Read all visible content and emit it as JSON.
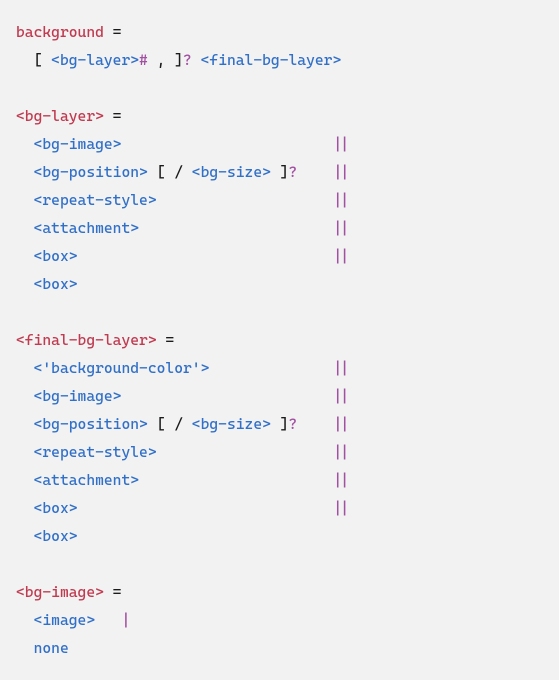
{
  "tokens": [
    {
      "id": "p1",
      "cls": "t-prop",
      "txt": "background"
    },
    {
      "id": "eq1",
      "cls": "t-pl",
      "txt": " = "
    },
    {
      "id": "br1",
      "cls": "t-pl",
      "txt": "[ "
    },
    {
      "id": "nt1",
      "cls": "t-nt",
      "txt": "<bg-layer>"
    },
    {
      "id": "op1",
      "cls": "t-op",
      "txt": "#"
    },
    {
      "id": "cm1",
      "cls": "t-pl",
      "txt": " , "
    },
    {
      "id": "br2",
      "cls": "t-pl",
      "txt": "]"
    },
    {
      "id": "op2",
      "cls": "t-op",
      "txt": "?"
    },
    {
      "id": "sp1",
      "cls": "t-pl",
      "txt": " "
    },
    {
      "id": "nt2",
      "cls": "t-nt",
      "txt": "<final-bg-layer>"
    },
    {
      "id": "p2",
      "cls": "t-prop",
      "txt": "<bg-layer>"
    },
    {
      "id": "eq2",
      "cls": "t-pl",
      "txt": " = "
    },
    {
      "id": "a1",
      "cls": "t-nt",
      "txt": "<bg-image>"
    },
    {
      "id": "a1o",
      "cls": "t-op",
      "txt": "||"
    },
    {
      "id": "a2",
      "cls": "t-nt",
      "txt": "<bg-position>"
    },
    {
      "id": "a2b1",
      "cls": "t-pl",
      "txt": " [ "
    },
    {
      "id": "a2s",
      "cls": "t-pl",
      "txt": "/ "
    },
    {
      "id": "a2n",
      "cls": "t-nt",
      "txt": "<bg-size>"
    },
    {
      "id": "a2b2",
      "cls": "t-pl",
      "txt": " ]"
    },
    {
      "id": "a2q",
      "cls": "t-op",
      "txt": "?"
    },
    {
      "id": "a2o",
      "cls": "t-op",
      "txt": "||"
    },
    {
      "id": "a3",
      "cls": "t-nt",
      "txt": "<repeat-style>"
    },
    {
      "id": "a3o",
      "cls": "t-op",
      "txt": "||"
    },
    {
      "id": "a4",
      "cls": "t-nt",
      "txt": "<attachment>"
    },
    {
      "id": "a4o",
      "cls": "t-op",
      "txt": "||"
    },
    {
      "id": "a5",
      "cls": "t-nt",
      "txt": "<box>"
    },
    {
      "id": "a5o",
      "cls": "t-op",
      "txt": "||"
    },
    {
      "id": "a6",
      "cls": "t-nt",
      "txt": "<box>"
    },
    {
      "id": "p3",
      "cls": "t-prop",
      "txt": "<final-bg-layer>"
    },
    {
      "id": "eq3",
      "cls": "t-pl",
      "txt": " = "
    },
    {
      "id": "b0",
      "cls": "t-str",
      "txt": "<'background-color'>"
    },
    {
      "id": "b0o",
      "cls": "t-op",
      "txt": "||"
    },
    {
      "id": "b1",
      "cls": "t-nt",
      "txt": "<bg-image>"
    },
    {
      "id": "b1o",
      "cls": "t-op",
      "txt": "||"
    },
    {
      "id": "b2",
      "cls": "t-nt",
      "txt": "<bg-position>"
    },
    {
      "id": "b2b1",
      "cls": "t-pl",
      "txt": " [ "
    },
    {
      "id": "b2s",
      "cls": "t-pl",
      "txt": "/ "
    },
    {
      "id": "b2n",
      "cls": "t-nt",
      "txt": "<bg-size>"
    },
    {
      "id": "b2b2",
      "cls": "t-pl",
      "txt": " ]"
    },
    {
      "id": "b2q",
      "cls": "t-op",
      "txt": "?"
    },
    {
      "id": "b2o",
      "cls": "t-op",
      "txt": "||"
    },
    {
      "id": "b3",
      "cls": "t-nt",
      "txt": "<repeat-style>"
    },
    {
      "id": "b3o",
      "cls": "t-op",
      "txt": "||"
    },
    {
      "id": "b4",
      "cls": "t-nt",
      "txt": "<attachment>"
    },
    {
      "id": "b4o",
      "cls": "t-op",
      "txt": "||"
    },
    {
      "id": "b5",
      "cls": "t-nt",
      "txt": "<box>"
    },
    {
      "id": "b5o",
      "cls": "t-op",
      "txt": "||"
    },
    {
      "id": "b6",
      "cls": "t-nt",
      "txt": "<box>"
    },
    {
      "id": "p4",
      "cls": "t-prop",
      "txt": "<bg-image>"
    },
    {
      "id": "eq4",
      "cls": "t-pl",
      "txt": " = "
    },
    {
      "id": "c1",
      "cls": "t-nt",
      "txt": "<image>"
    },
    {
      "id": "c1o",
      "cls": "t-op",
      "txt": "|"
    },
    {
      "id": "c2",
      "cls": "t-kw",
      "txt": "none"
    }
  ],
  "layout": {
    "indent": "  ",
    "opcol": 36
  }
}
